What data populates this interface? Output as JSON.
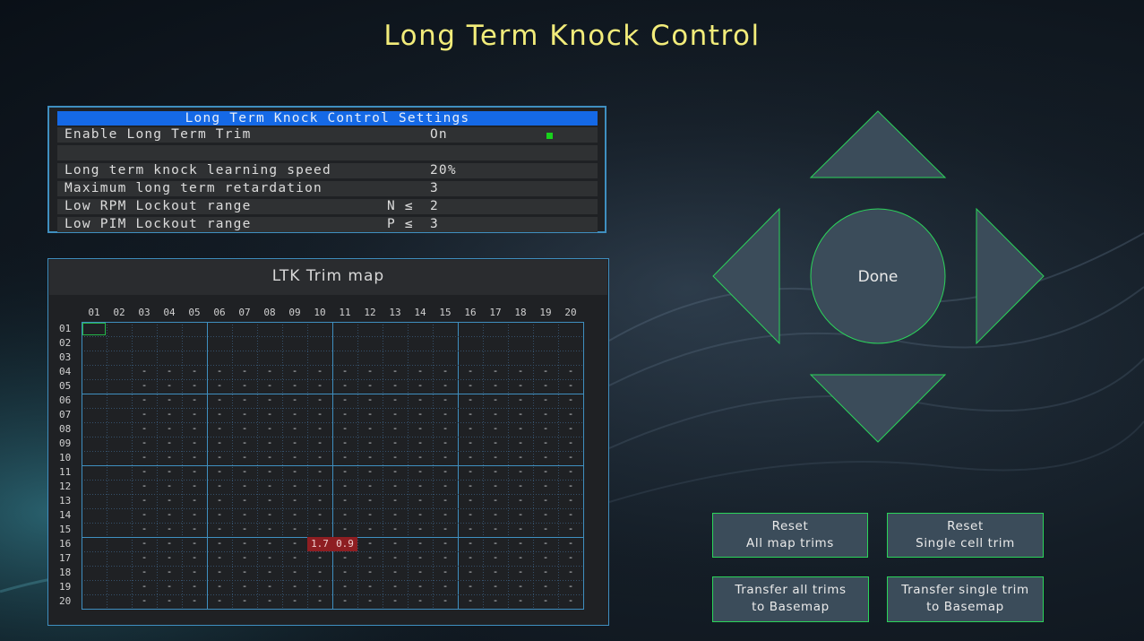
{
  "title": "Long Term Knock Control",
  "settings": {
    "header": "Long Term Knock Control Settings",
    "rows": [
      {
        "label": "Enable Long Term Trim",
        "cmp": "",
        "value": "On"
      },
      {
        "label": "",
        "cmp": "",
        "value": ""
      },
      {
        "label": "Long term knock learning speed",
        "cmp": "",
        "value": "20%"
      },
      {
        "label": "Maximum long term retardation",
        "cmp": "",
        "value": "3"
      },
      {
        "label": "Low RPM Lockout range",
        "cmp": "N ≤",
        "value": "2"
      },
      {
        "label": "Low PIM Lockout range",
        "cmp": "P ≤",
        "value": "3"
      }
    ],
    "indicator_color": "#18d21c"
  },
  "trim_map": {
    "title": "LTK Trim map",
    "columns": [
      "01",
      "02",
      "03",
      "04",
      "05",
      "06",
      "07",
      "08",
      "09",
      "10",
      "11",
      "12",
      "13",
      "14",
      "15",
      "16",
      "17",
      "18",
      "19",
      "20"
    ],
    "rows": [
      "01",
      "02",
      "03",
      "04",
      "05",
      "06",
      "07",
      "08",
      "09",
      "10",
      "11",
      "12",
      "13",
      "14",
      "15",
      "16",
      "17",
      "18",
      "19",
      "20"
    ],
    "empty_marker": "-",
    "dash_start_row": 4,
    "dash_start_col": 3,
    "selected_cell": {
      "row": 1,
      "col": 1
    },
    "trims": [
      {
        "row": 16,
        "col": 10,
        "value": "1.7"
      },
      {
        "row": 16,
        "col": 11,
        "value": "0.9"
      }
    ]
  },
  "dpad": {
    "up": "up-arrow",
    "down": "down-arrow",
    "left": "left-arrow",
    "right": "right-arrow",
    "center_label": "Done",
    "fill": "#3b4c5a",
    "stroke": "#2bd45a"
  },
  "buttons": {
    "reset_all_line1": "Reset",
    "reset_all_line2": "All map trims",
    "reset_single_line1": "Reset",
    "reset_single_line2": "Single cell trim",
    "transfer_all_line1": "Transfer all trims",
    "transfer_all_line2": "to Basemap",
    "transfer_single_line1": "Transfer single trim",
    "transfer_single_line2": "to Basemap"
  }
}
